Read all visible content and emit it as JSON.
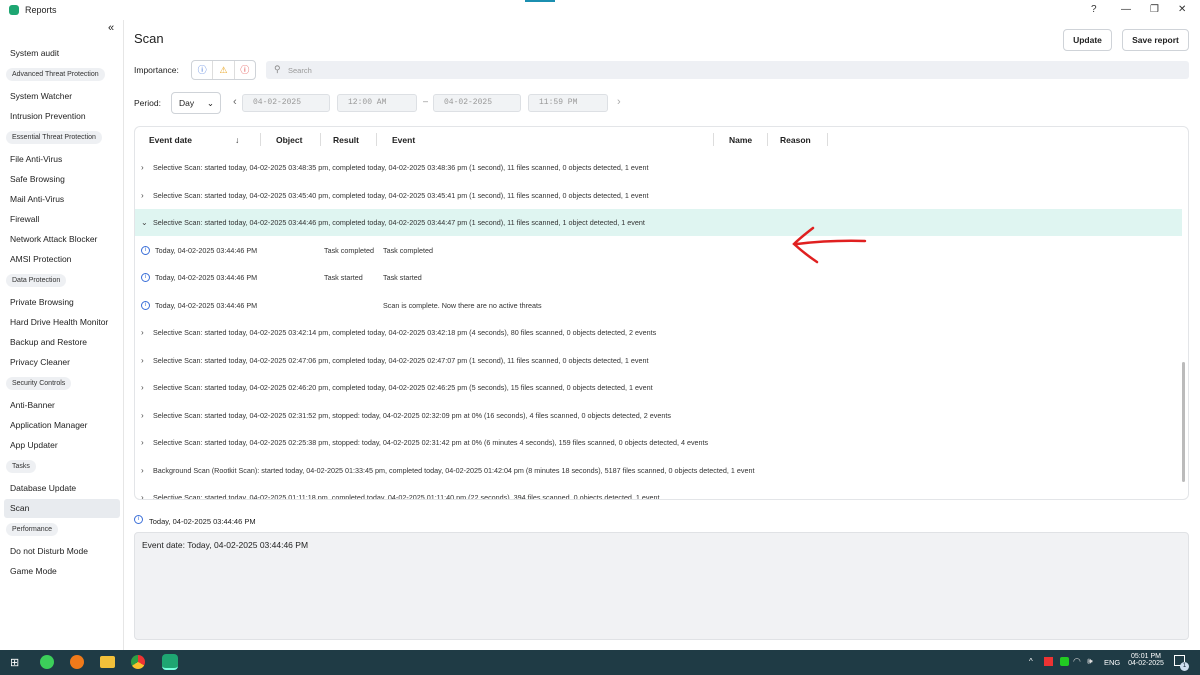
{
  "window": {
    "title": "Reports",
    "controls": [
      "?",
      "—",
      "❐",
      "✕"
    ]
  },
  "sidebar": {
    "collapse_icon": "«",
    "items": [
      {
        "type": "item",
        "label": "System audit"
      },
      {
        "type": "header",
        "label": "Advanced Threat Protection"
      },
      {
        "type": "item",
        "label": "System Watcher"
      },
      {
        "type": "item",
        "label": "Intrusion Prevention"
      },
      {
        "type": "header",
        "label": "Essential Threat Protection"
      },
      {
        "type": "item",
        "label": "File Anti-Virus"
      },
      {
        "type": "item",
        "label": "Safe Browsing"
      },
      {
        "type": "item",
        "label": "Mail Anti-Virus"
      },
      {
        "type": "item",
        "label": "Firewall"
      },
      {
        "type": "item",
        "label": "Network Attack Blocker"
      },
      {
        "type": "item",
        "label": "AMSI Protection"
      },
      {
        "type": "header",
        "label": "Data Protection"
      },
      {
        "type": "item",
        "label": "Private Browsing"
      },
      {
        "type": "item",
        "label": "Hard Drive Health Monitor"
      },
      {
        "type": "item",
        "label": "Backup and Restore"
      },
      {
        "type": "item",
        "label": "Privacy Cleaner"
      },
      {
        "type": "header",
        "label": "Security Controls"
      },
      {
        "type": "item",
        "label": "Anti-Banner"
      },
      {
        "type": "item",
        "label": "Application Manager"
      },
      {
        "type": "item",
        "label": "App Updater"
      },
      {
        "type": "header",
        "label": "Tasks"
      },
      {
        "type": "item",
        "label": "Database Update"
      },
      {
        "type": "item",
        "label": "Scan",
        "selected": true
      },
      {
        "type": "header",
        "label": "Performance"
      },
      {
        "type": "item",
        "label": "Do not Disturb Mode"
      },
      {
        "type": "item",
        "label": "Game Mode"
      }
    ]
  },
  "main": {
    "title": "Scan",
    "update_label": "Update",
    "save_label": "Save report",
    "importance_label": "Importance:",
    "search_placeholder": "Search",
    "period_label": "Period:",
    "period_value": "Day",
    "date_from": "04-02-2025",
    "time_from": "12:00 AM",
    "date_to": "04-02-2025",
    "time_to": "11:59 PM"
  },
  "table": {
    "columns": [
      "Event date",
      "Object",
      "Result",
      "Event",
      "Name",
      "Reason"
    ],
    "rows": [
      {
        "kind": "group",
        "text": "Selective Scan: started today, 04-02-2025 03:48:35 pm, completed today, 04-02-2025 03:48:36 pm (1 second), 11 files scanned, 0 objects detected, 1 event"
      },
      {
        "kind": "group",
        "text": "Selective Scan: started today, 04-02-2025 03:45:40 pm, completed today, 04-02-2025 03:45:41 pm (1 second), 11 files scanned, 0 objects detected, 1 event"
      },
      {
        "kind": "group",
        "expanded": true,
        "text": "Selective Scan: started today, 04-02-2025 03:44:46 pm, completed today, 04-02-2025 03:44:47 pm (1 second), 11 files scanned, 1 object detected, 1 event"
      },
      {
        "kind": "event",
        "date": "Today, 04-02-2025 03:44:46 PM",
        "result": "Task completed",
        "event": "Task completed"
      },
      {
        "kind": "event",
        "date": "Today, 04-02-2025 03:44:46 PM",
        "result": "Task started",
        "event": "Task started"
      },
      {
        "kind": "event",
        "date": "Today, 04-02-2025 03:44:46 PM",
        "result": "",
        "event": "Scan is complete. Now there are no active threats"
      },
      {
        "kind": "group",
        "text": "Selective Scan: started today, 04-02-2025 03:42:14 pm, completed today, 04-02-2025 03:42:18 pm (4 seconds), 80 files scanned, 0 objects detected, 2 events"
      },
      {
        "kind": "group",
        "text": "Selective Scan: started today, 04-02-2025 02:47:06 pm, completed today, 04-02-2025 02:47:07 pm (1 second), 11 files scanned, 0 objects detected, 1 event"
      },
      {
        "kind": "group",
        "text": "Selective Scan: started today, 04-02-2025 02:46:20 pm, completed today, 04-02-2025 02:46:25 pm (5 seconds), 15 files scanned, 0 objects detected, 1 event"
      },
      {
        "kind": "group",
        "text": "Selective Scan: started today, 04-02-2025 02:31:52 pm, stopped: today, 04-02-2025 02:32:09 pm at 0% (16 seconds), 4 files scanned, 0 objects detected, 2 events"
      },
      {
        "kind": "group",
        "text": "Selective Scan: started today, 04-02-2025 02:25:38 pm, stopped: today, 04-02-2025 02:31:42 pm at 0% (6 minutes 4 seconds), 159 files scanned, 0 objects detected, 4 events"
      },
      {
        "kind": "group",
        "text": "Background Scan (Rootkit Scan): started today, 04-02-2025 01:33:45 pm, completed today, 04-02-2025 01:42:04 pm (8 minutes 18 seconds), 5187 files scanned, 0 objects detected, 1 event"
      },
      {
        "kind": "group",
        "text": "Selective Scan: started today, 04-02-2025 01:11:18 pm, completed today, 04-02-2025 01:11:40 pm (22 seconds), 394 files scanned, 0 objects detected, 1 event"
      }
    ]
  },
  "details": {
    "header": "Today, 04-02-2025 03:44:46 PM",
    "body": "Event date: Today, 04-02-2025 03:44:46 PM"
  },
  "taskbar": {
    "lang": "ENG",
    "time": "05:01 PM",
    "date": "04-02-2025",
    "notif_count": "1"
  },
  "colors": {
    "accent": "#1ea672",
    "selected_row": "#dff5f1",
    "taskbar": "#1f3b45",
    "annotation": "#e02020"
  }
}
